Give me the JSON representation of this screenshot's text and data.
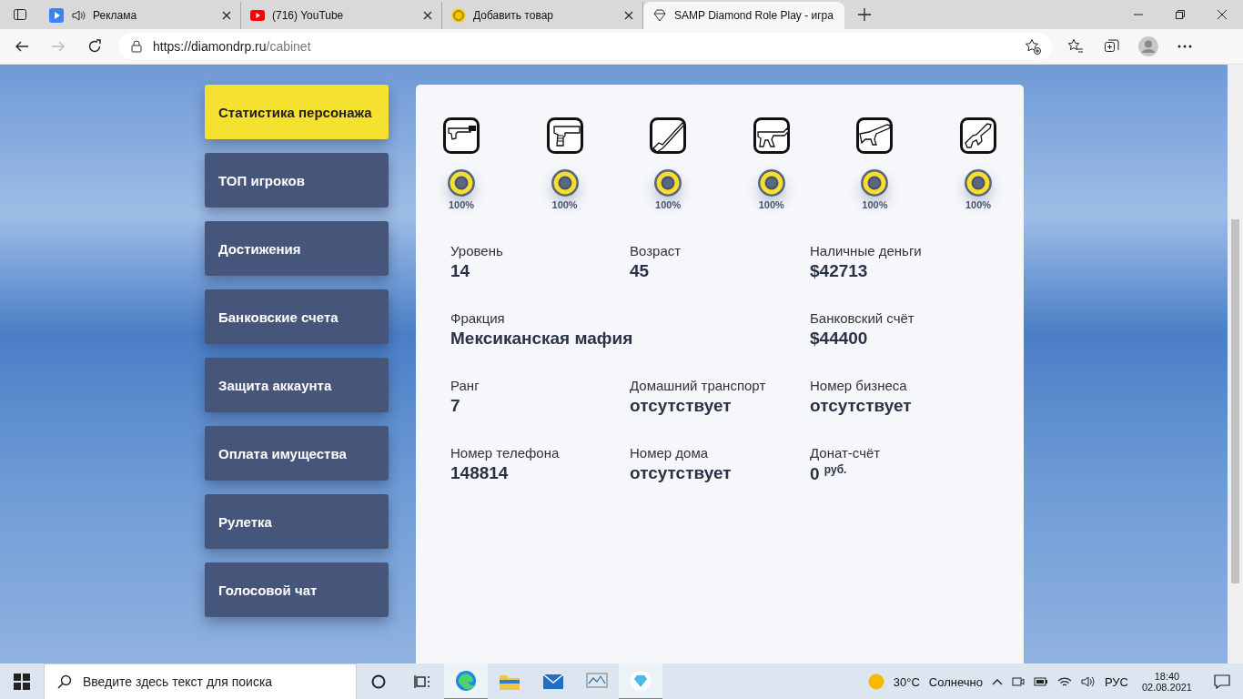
{
  "browser": {
    "tabs": [
      {
        "title": "Реклама",
        "kind": "play",
        "audio": true,
        "selected": false
      },
      {
        "title": "(716) YouTube",
        "kind": "video",
        "audio": false,
        "selected": false
      },
      {
        "title": "Добавить товар",
        "kind": "coin",
        "audio": false,
        "selected": false
      },
      {
        "title": "SAMP Diamond Role Play - игра",
        "kind": "diamond",
        "audio": false,
        "selected": true
      }
    ],
    "url_host": "https://diamondrp.ru",
    "url_path": "/cabinet"
  },
  "sidebar": {
    "items": [
      {
        "label": "Статистика персонажа",
        "selected": true
      },
      {
        "label": "ТОП игроков",
        "selected": false
      },
      {
        "label": "Достижения",
        "selected": false
      },
      {
        "label": "Банковские счета",
        "selected": false
      },
      {
        "label": "Защита аккаунта",
        "selected": false
      },
      {
        "label": "Оплата имущества",
        "selected": false
      },
      {
        "label": "Рулетка",
        "selected": false
      },
      {
        "label": "Голосовой чат",
        "selected": false
      }
    ]
  },
  "weapons": [
    {
      "kind": "silenced-pistol",
      "level": 1,
      "reading": "100%"
    },
    {
      "kind": "pistol",
      "level": 1,
      "reading": "100%"
    },
    {
      "kind": "shotgun",
      "level": 1,
      "reading": "100%"
    },
    {
      "kind": "smg",
      "level": 1,
      "reading": "100%"
    },
    {
      "kind": "rifle",
      "level": 1,
      "reading": "100%"
    },
    {
      "kind": "carbine",
      "level": 1,
      "reading": "100%"
    }
  ],
  "stats": [
    {
      "label": "Уровень",
      "value": "14",
      "kind": "normal"
    },
    {
      "label": "Возраст",
      "value": "45",
      "kind": "normal"
    },
    {
      "label": "Наличные деньги",
      "value": "$42713",
      "kind": "normal"
    },
    {
      "label": "Фракция",
      "value": "Мексиканская мафия",
      "kind": "wide"
    },
    {
      "label": "Банковский счёт",
      "value": "$44400",
      "kind": "normal"
    },
    {
      "label": "Ранг",
      "value": "7",
      "kind": "normal"
    },
    {
      "label": "Домашний транспорт",
      "value": "отсутствует",
      "kind": "normal"
    },
    {
      "label": "Номер бизнеса",
      "value": "отсутствует",
      "kind": "normal"
    },
    {
      "label": "Номер телефона",
      "value": "148814",
      "kind": "normal"
    },
    {
      "label": "Номер дома",
      "value": "отсутствует",
      "kind": "normal"
    },
    {
      "label": "Донат-счёт",
      "value": "0 $^{руб.}$",
      "kind": "normal"
    }
  ],
  "taskbar": {
    "search_placeholder": "Введите здесь текст для поиска",
    "weather": "30°C",
    "weather_text": "Солнечно",
    "language": "РУС",
    "time": "18:40",
    "date": "02.08.2021"
  }
}
